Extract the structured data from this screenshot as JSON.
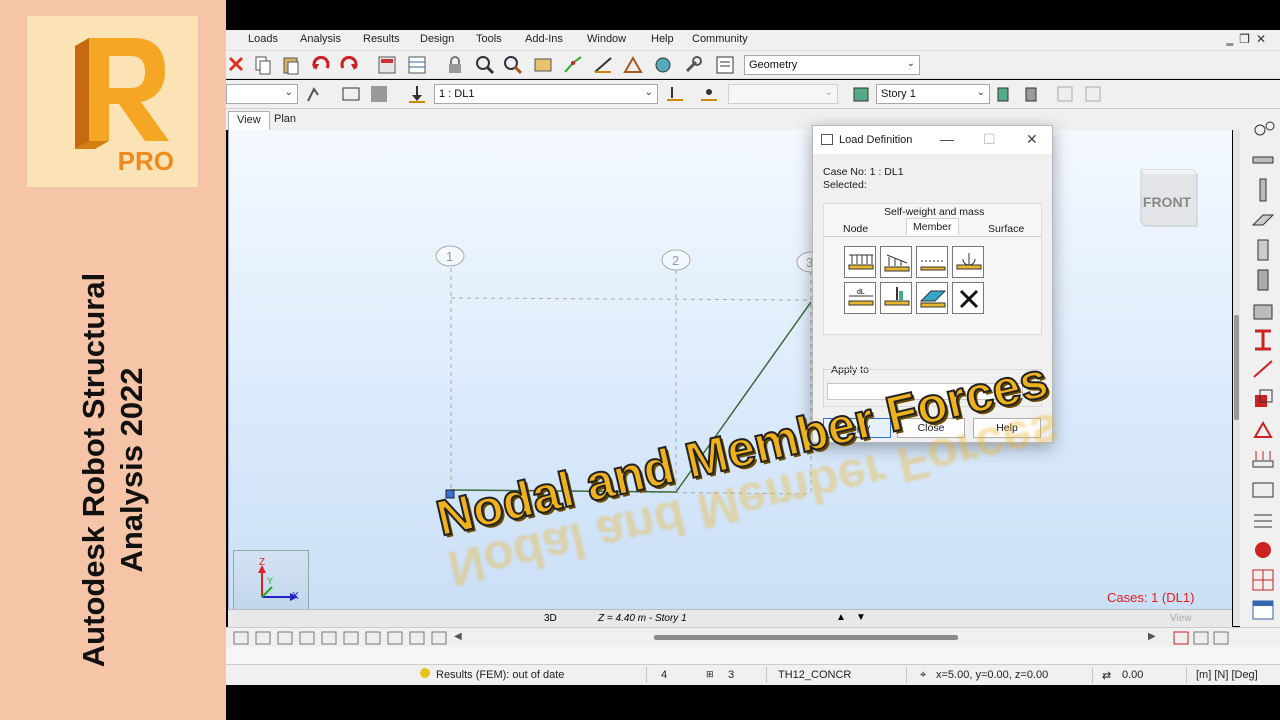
{
  "brand": {
    "logo_letter": "R",
    "logo_badge": "PRO",
    "title_line1": "Autodesk Robot Structural",
    "title_line2": "Analysis 2022"
  },
  "menubar": {
    "items": [
      "Loads",
      "Analysis",
      "Results",
      "Design",
      "Tools",
      "Add-Ins",
      "Window",
      "Help",
      "Community"
    ]
  },
  "toolbar": {
    "layout_combo": "Geometry",
    "case_combo": "1 : DL1",
    "story_combo": "Story 1"
  },
  "view_tabs": [
    "View",
    "Plan"
  ],
  "viewport": {
    "grid_labels": [
      "1",
      "2",
      "3"
    ],
    "view_cube_label": "FRONT",
    "axes": {
      "z": "Z",
      "y": "Y",
      "x": "X"
    },
    "cases_label": "Cases: 1 (DL1)"
  },
  "viewtabs_strip": {
    "mode": "3D",
    "level": "Z = 4.40 m - Story 1",
    "view_label": "View"
  },
  "statusbar": {
    "results": "Results (FEM): out of date",
    "count1": "4",
    "count2": "3",
    "section": "TH12_CONCR",
    "coords": "x=5.00, y=0.00, z=0.00",
    "value": "0.00",
    "units": "[m] [N] [Deg]"
  },
  "dialog": {
    "title": "Load Definition",
    "case_no": "Case No: 1 : DL1",
    "selected": "Selected:",
    "group_label": "Self-weight and mass",
    "tabs": [
      "Node",
      "Member",
      "Surface"
    ],
    "apply_to_label": "Apply to",
    "apply_to_value": "",
    "buttons": {
      "apply": "Apply",
      "close": "Close",
      "help": "Help"
    }
  },
  "overlay_title": "Nodal and Member Forces",
  "colors": {
    "brand_bg": "#f6c4a6",
    "logo_accent": "#f08a1c",
    "cases_red": "#e81c1c",
    "overlay_gold": "#f0b21c"
  }
}
